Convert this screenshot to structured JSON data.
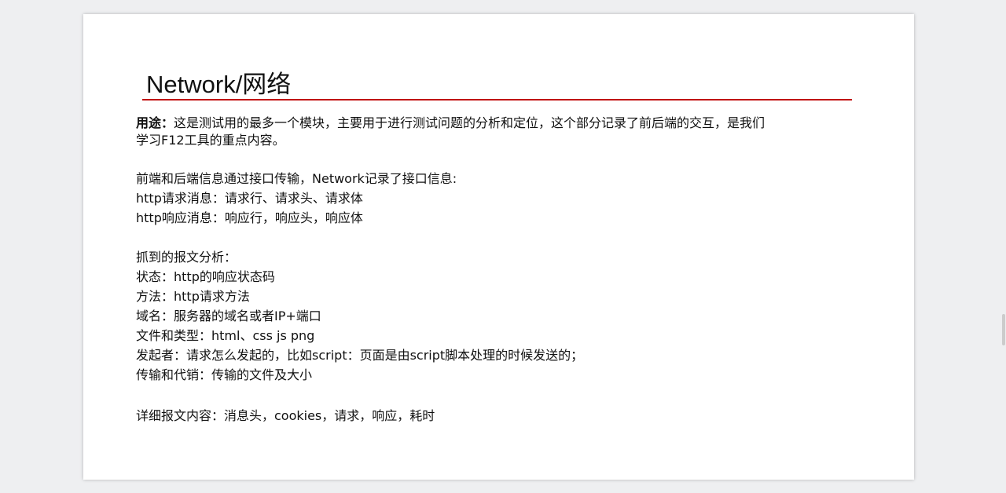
{
  "slide": {
    "title": "Network/网络",
    "usage_label": "用途：",
    "usage_text_1": "这是测试用的最多一个模块，主要用于进行测试问题的分析和定位，这个部分记录了前后端的交互，是我们",
    "usage_text_2": "学习F12工具的重点内容。",
    "para1": [
      "前端和后端信息通过接口传输，Network记录了接口信息:",
      "http请求消息：请求行、请求头、请求体",
      "http响应消息：响应行，响应头，响应体"
    ],
    "para2": [
      "抓到的报文分析：",
      "状态：http的响应状态码",
      "方法：http请求方法",
      "域名：服务器的域名或者IP+端口",
      "文件和类型：html、css  js  png",
      "发起者：请求怎么发起的，比如script：页面是由script脚本处理的时候发送的；",
      "传输和代销：传输的文件及大小"
    ],
    "para3": "详细报文内容：消息头，cookies，请求，响应，耗时"
  },
  "colors": {
    "rule": "#c00000",
    "background": "#eeeff1"
  }
}
